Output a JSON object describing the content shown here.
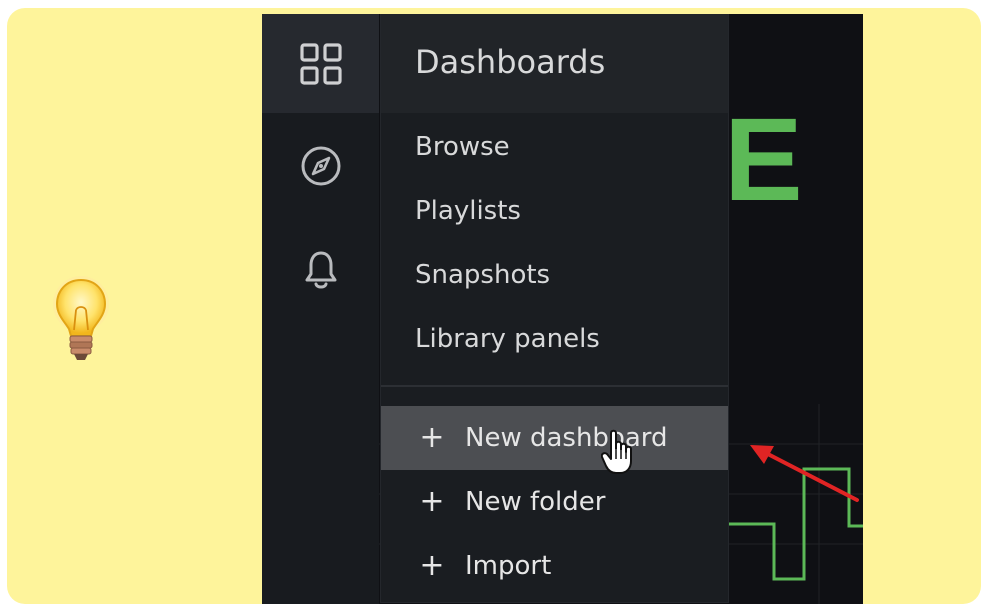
{
  "menu": {
    "title": "Dashboards",
    "items": [
      {
        "label": "Browse"
      },
      {
        "label": "Playlists"
      },
      {
        "label": "Snapshots"
      },
      {
        "label": "Library panels"
      }
    ],
    "actions": [
      {
        "label": "New dashboard",
        "hovered": true
      },
      {
        "label": "New folder",
        "hovered": false
      },
      {
        "label": "Import",
        "hovered": false
      }
    ]
  },
  "background": {
    "headline": "INE"
  },
  "sidebar": {
    "icons": [
      "dashboards-grid-icon",
      "explore-compass-icon",
      "alerting-bell-icon"
    ]
  },
  "colors": {
    "callout_bg": "#fef49b",
    "panel_green": "#5cb957",
    "arrow_red": "#e02424",
    "menu_bg": "#1a1d21",
    "hover_bg": "#4c4e52"
  }
}
